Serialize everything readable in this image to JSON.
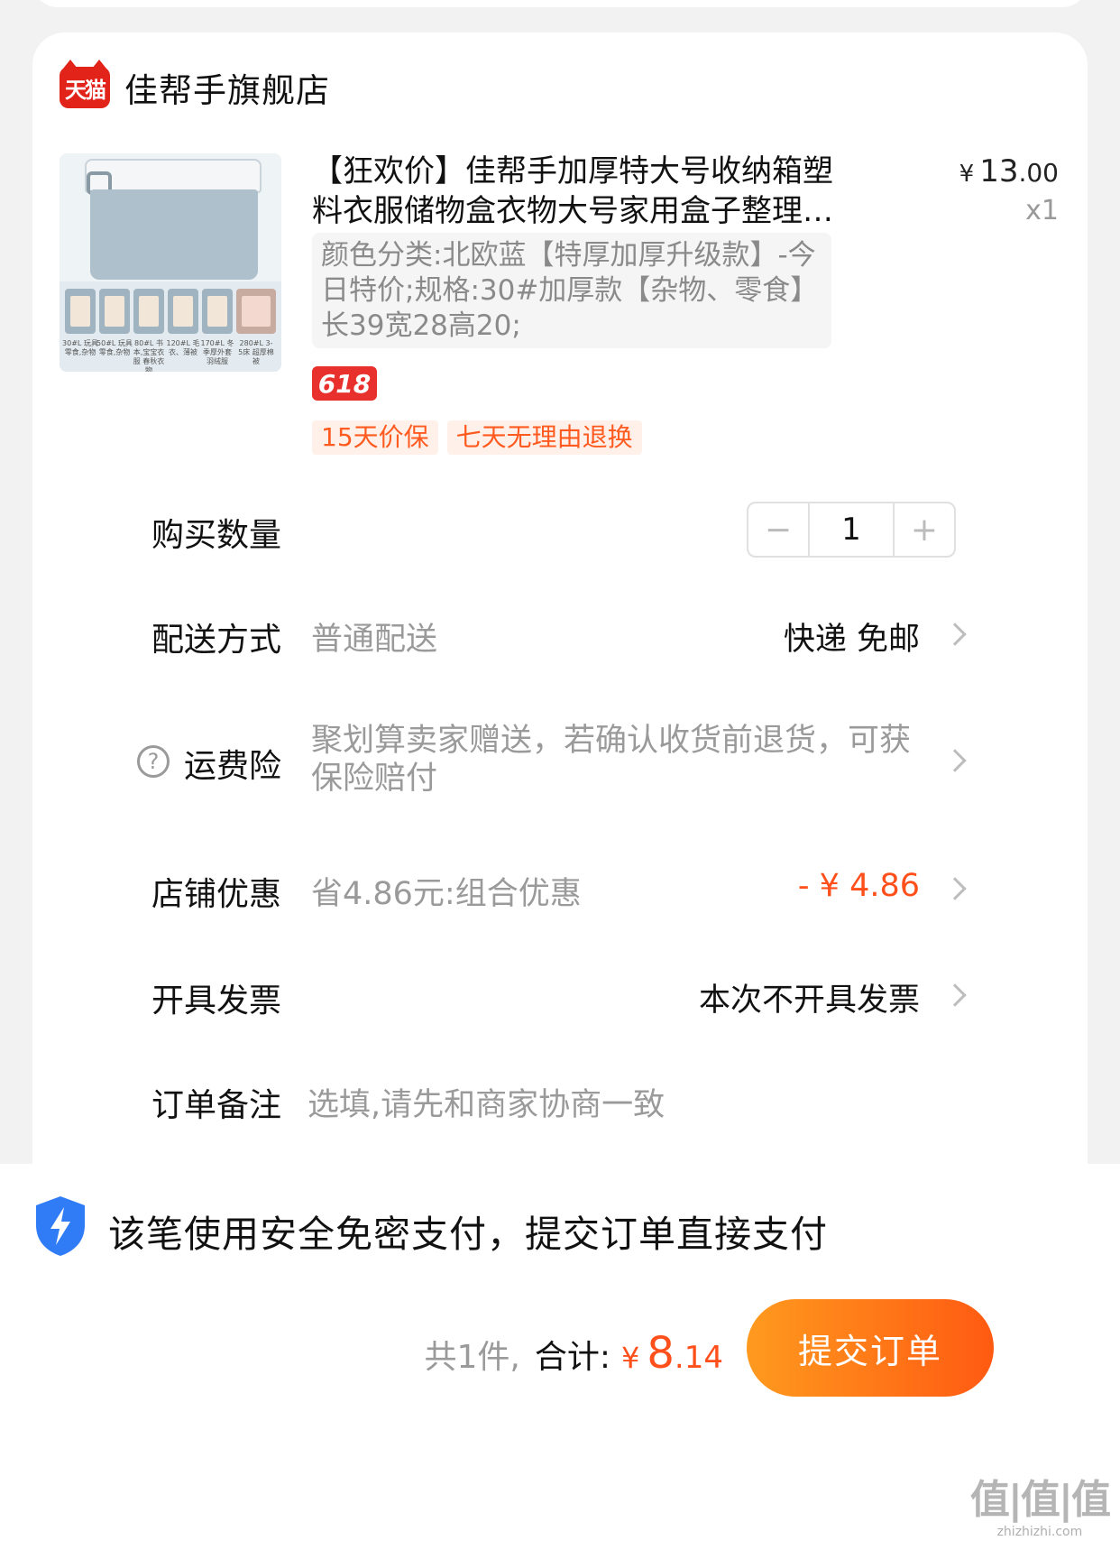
{
  "shop": {
    "platform_logo": "天猫",
    "name": "佳帮手旗舰店"
  },
  "product": {
    "title": "【狂欢价】佳帮手加厚特大号收纳箱塑料衣服储物盒衣物大号家用盒子整理…",
    "price_symbol": "¥",
    "price_int": "13",
    "price_dec": ".00",
    "quantity_label": "x1",
    "sku": "颜色分类:北欧蓝【特厚加厚升级款】-今日特价;规格:30#加厚款【杂物、零食】长39宽28高20;",
    "promo_badge": "618",
    "tags": [
      "15天价保",
      "七天无理由退换"
    ],
    "image_captions": [
      "30#L 玩具 零食,杂物",
      "50#L 玩具 零食,杂物",
      "80#L 书本,宝宝衣服 春秋衣物",
      "120#L 毛衣、薄被",
      "170#L 冬季厚外套 羽绒服",
      "280#L 3-5床 超厚棉被"
    ]
  },
  "rows": {
    "quantity": {
      "label": "购买数量",
      "value": "1",
      "minus": "−",
      "plus": "+"
    },
    "delivery": {
      "label": "配送方式",
      "sub": "普通配送",
      "value": "快递 免邮"
    },
    "insurance": {
      "label": "运费险",
      "sub": "聚划算卖家赠送，若确认收货前退货，可获保险赔付",
      "help": "?"
    },
    "discount": {
      "label": "店铺优惠",
      "sub": "省4.86元:组合优惠",
      "value": "- ¥ 4.86"
    },
    "invoice": {
      "label": "开具发票",
      "value": "本次不开具发票"
    },
    "note": {
      "label": "订单备注",
      "placeholder": "选填,请先和商家协商一致"
    }
  },
  "footer": {
    "secure_text": "该笔使用安全免密支付，提交订单直接支付",
    "count_text": "共1件,",
    "total_label": "合计:",
    "total_symbol": "¥",
    "total_int": "8",
    "total_dec": ".14",
    "submit_label": "提交订单",
    "watermark": "值|值|值",
    "watermark_sub": "zhizhizhi.com"
  },
  "colors": {
    "accent": "#ff4f1a",
    "brand_red": "#e2231a",
    "button_start": "#ff9a1e",
    "button_end": "#ff5a12",
    "shield_blue": "#2f7cf6"
  }
}
